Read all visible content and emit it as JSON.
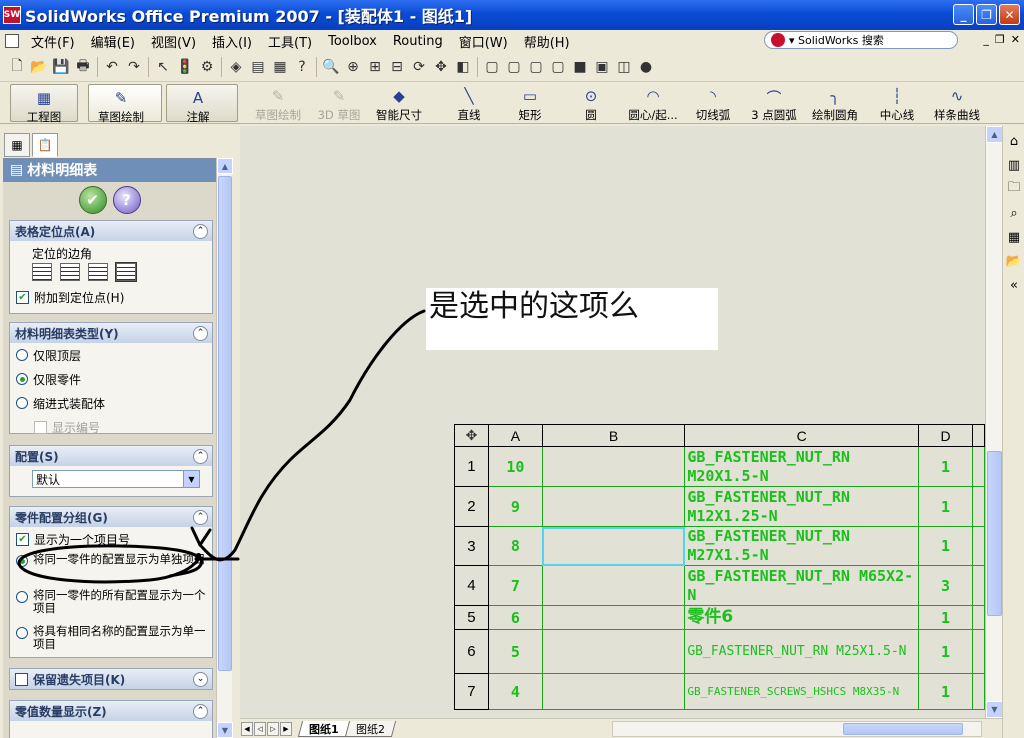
{
  "window": {
    "title": "SolidWorks Office Premium 2007 - [装配体1 - 图纸1]",
    "app_icon": "SW",
    "controls": [
      "_",
      "❐",
      "✕"
    ]
  },
  "menubar": {
    "items": [
      "文件(F)",
      "编辑(E)",
      "视图(V)",
      "插入(I)",
      "工具(T)",
      "Toolbox",
      "Routing",
      "窗口(W)",
      "帮助(H)"
    ],
    "search_text": "▾ SolidWorks 搜索",
    "mdi_controls": [
      "_",
      "❐",
      "✕"
    ]
  },
  "command_manager": {
    "tabs": [
      "工程图",
      "草图绘制",
      "注解"
    ],
    "tools": [
      {
        "label": "草图绘制",
        "icon": "sketch-icon",
        "disabled": true
      },
      {
        "label": "3D 草图",
        "icon": "3d-sketch-icon",
        "disabled": true
      },
      {
        "label": "智能尺寸",
        "icon": "smart-dimension-icon",
        "disabled": false
      },
      {
        "label": "直线",
        "icon": "line-icon",
        "disabled": false
      },
      {
        "label": "矩形",
        "icon": "rectangle-icon",
        "disabled": false
      },
      {
        "label": "圆",
        "icon": "circle-icon",
        "disabled": false
      },
      {
        "label": "圆心/起...",
        "icon": "center-arc-icon",
        "disabled": false
      },
      {
        "label": "切线弧",
        "icon": "tangent-arc-icon",
        "disabled": false
      },
      {
        "label": "3 点圆弧",
        "icon": "three-point-arc-icon",
        "disabled": false
      },
      {
        "label": "绘制圆角",
        "icon": "fillet-icon",
        "disabled": false
      },
      {
        "label": "中心线",
        "icon": "centerline-icon",
        "disabled": false
      },
      {
        "label": "样条曲线",
        "icon": "spline-icon",
        "disabled": false
      }
    ]
  },
  "property_manager": {
    "title": "材料明细表",
    "groups": {
      "anchor": {
        "title": "表格定位点(A)",
        "subtitle": "定位的边角",
        "attach_label": "附加到定位点(H)",
        "attach_checked": true
      },
      "bom_type": {
        "title": "材料明细表类型(Y)",
        "options": [
          "仅限顶层",
          "仅限零件",
          "缩进式装配体"
        ],
        "selected": 1,
        "show_number": "显示编号"
      },
      "config": {
        "title": "配置(S)",
        "value": "默认"
      },
      "part_config_grouping": {
        "title": "零件配置分组(G)",
        "display_as_one": "显示为一个项目号",
        "options": [
          "将同一零件的配置显示为单独项目",
          "将同一零件的所有配置显示为一个项目",
          "将具有相同名称的配置显示为单一项目"
        ],
        "selected": 0
      },
      "keep_missing": {
        "title": "保留遗失项目(K)"
      },
      "zero_qty": {
        "title": "零值数量显示(Z)"
      }
    }
  },
  "annotation_note": "是选中的这项么",
  "bom_table": {
    "columns": [
      "A",
      "B",
      "C",
      "D"
    ],
    "rows": [
      {
        "num": "1",
        "a": "10",
        "b": "",
        "c": "GB_FASTENER_NUT_RN M20X1.5-N",
        "d": "1"
      },
      {
        "num": "2",
        "a": "9",
        "b": "",
        "c": "GB_FASTENER_NUT_RN M12X1.25-N",
        "d": "1"
      },
      {
        "num": "3",
        "a": "8",
        "b": "",
        "c": "GB_FASTENER_NUT_RN M27X1.5-N",
        "d": "1"
      },
      {
        "num": "4",
        "a": "7",
        "b": "",
        "c": "GB_FASTENER_NUT_RN M65X2-N",
        "d": "3"
      },
      {
        "num": "5",
        "a": "6",
        "b": "",
        "c": "零件6",
        "d": "1"
      },
      {
        "num": "6",
        "a": "5",
        "b": "",
        "c": "GB_FASTENER_NUT_RN M25X1.5-N",
        "d": "1"
      },
      {
        "num": "7",
        "a": "4",
        "b": "",
        "c": "GB_FASTENER_SCREWS_HSHCS M8X35-N",
        "d": "1"
      }
    ]
  },
  "sheets": {
    "tabs": [
      "图纸1",
      "图纸2"
    ],
    "active": 0
  }
}
